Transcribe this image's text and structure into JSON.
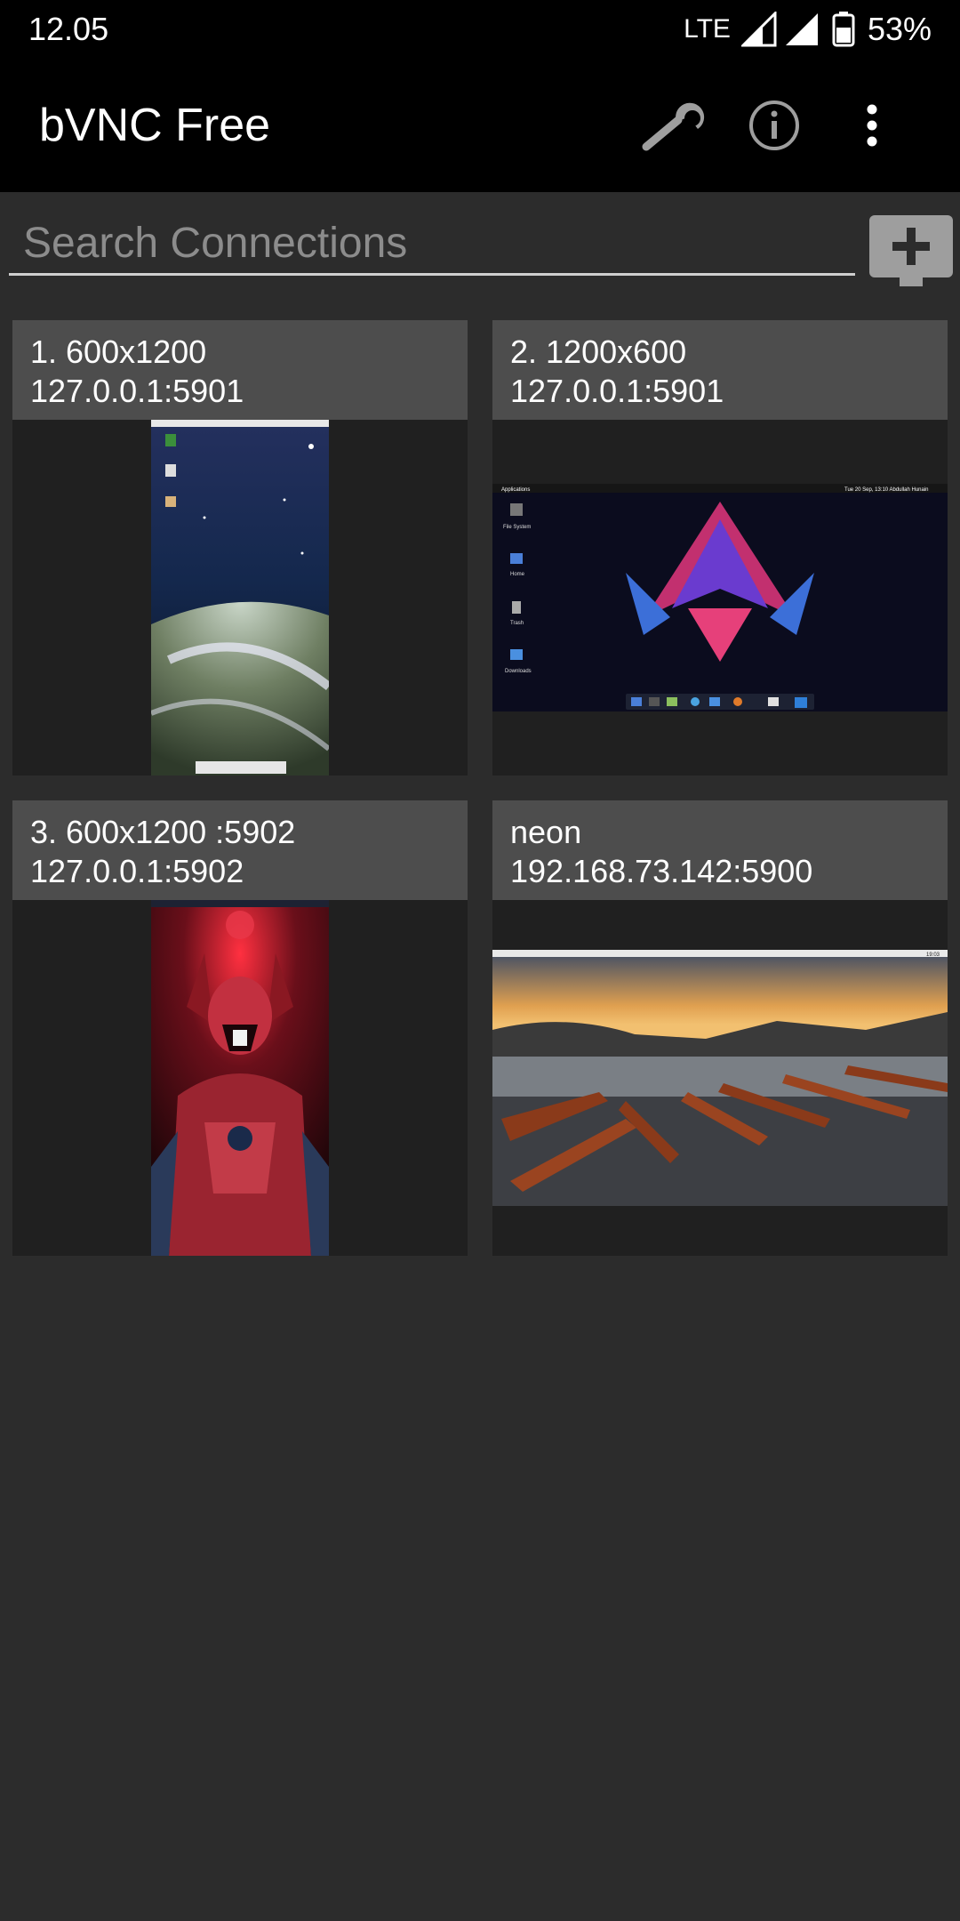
{
  "status_bar": {
    "time": "12.05",
    "network": "LTE",
    "battery": "53%"
  },
  "app_bar": {
    "title": "bVNC Free",
    "icons": [
      "wrench-icon",
      "info-icon",
      "overflow-menu-icon"
    ]
  },
  "search": {
    "placeholder": "Search Connections",
    "value": "",
    "new_connection_icon": "add-monitor-icon"
  },
  "connections": [
    {
      "name": "1. 600x1200",
      "address": "127.0.0.1:5901",
      "thumbnail": "portrait-desktop-earth-space"
    },
    {
      "name": "2. 1200x600",
      "address": "127.0.0.1:5901",
      "thumbnail": "landscape-desktop-neon-triangles",
      "thumb_text": {
        "menu": "Applications",
        "clock": "Tue 20 Sep, 13:10 Abdullah Hunain",
        "icons": [
          "File System",
          "Home",
          "Trash",
          "Downloads"
        ]
      }
    },
    {
      "name": "3. 600x1200 :5902",
      "address": "127.0.0.1:5902",
      "thumbnail": "portrait-desktop-red-character"
    },
    {
      "name": "neon",
      "address": "192.168.73.142:5900",
      "thumbnail": "landscape-desktop-lake-boats",
      "thumb_text": {
        "clock": "19:03"
      }
    }
  ],
  "colors": {
    "background": "#2c2c2c",
    "bar": "#000000",
    "card_header": "#4d4d4d",
    "card_body": "#202020",
    "icon_gray": "#9e9e9e"
  }
}
